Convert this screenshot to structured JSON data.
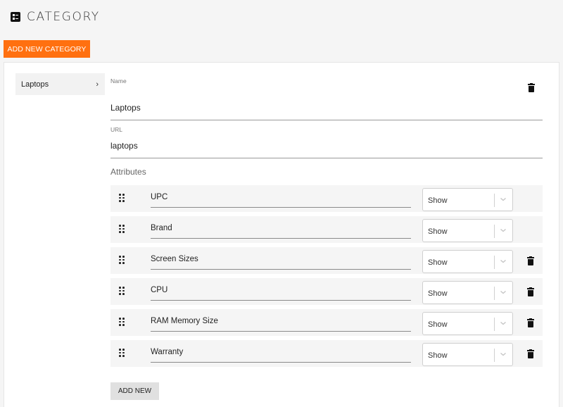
{
  "header": {
    "title": "CATEGORY",
    "icon": "category-list-icon"
  },
  "toolbar": {
    "add_category_label": "ADD NEW CATEGORY",
    "accent_color": "#ff7010"
  },
  "categories": [
    {
      "label": "Laptops",
      "selected": true
    }
  ],
  "form": {
    "name_label": "Name",
    "name_value": "Laptops",
    "url_label": "URL",
    "url_value": "laptops",
    "attributes_title": "Attributes",
    "attributes": [
      {
        "name": "UPC",
        "visibility": "Show",
        "deletable": false
      },
      {
        "name": "Brand",
        "visibility": "Show",
        "deletable": false
      },
      {
        "name": "Screen Sizes",
        "visibility": "Show",
        "deletable": true
      },
      {
        "name": "CPU",
        "visibility": "Show",
        "deletable": true
      },
      {
        "name": "RAM Memory Size",
        "visibility": "Show",
        "deletable": true
      },
      {
        "name": "Warranty",
        "visibility": "Show",
        "deletable": true
      }
    ],
    "add_new_label": "ADD NEW"
  }
}
